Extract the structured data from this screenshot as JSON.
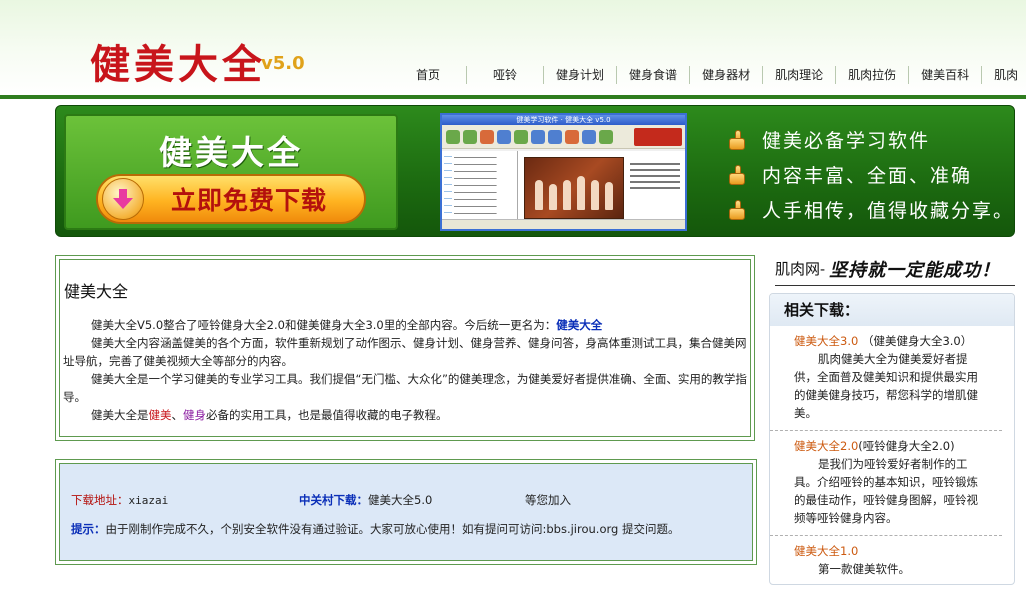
{
  "header": {
    "logo_text": "健美大全",
    "version": "v5.0",
    "nav": [
      "首页",
      "哑铃",
      "健身计划",
      "健身食谱",
      "健身器材",
      "肌肉理论",
      "肌肉拉伤",
      "健美百科",
      "肌肉"
    ]
  },
  "banner": {
    "title": "健美大全",
    "download_button": "立即免费下载",
    "download_icon": "download-arrow-icon",
    "screenshot_title": "健美学习软件 · 健美大全 v5.0",
    "features": [
      "健美必备学习软件",
      "内容丰富、全面、准确",
      "人手相传，值得收藏分享。"
    ]
  },
  "intro": {
    "title": "健美大全",
    "p1_text": "健美大全V5.0整合了哑铃健身大全2.0和健美健身大全3.0里的全部内容。今后统一更名为：",
    "p1_highlight": "健美大全",
    "p2": "健美大全内容涵盖健美的各个方面，软件重新规划了动作图示、健身计划、健身营养、健身问答，身高体重测试工具，集合健美网址导航，完善了健美视频大全等部分的内容。",
    "p3": "健美大全是一个学习健美的专业学习工具。我们提倡“无门槛、大众化”的健美理念，为健美爱好者提供准确、全面、实用的教学指导。",
    "p4_a": "健美大全是",
    "p4_b": "健美",
    "p4_sep": "、",
    "p4_c": "健身",
    "p4_d": "必备的实用工具，也是最值得收藏的电子教程。"
  },
  "download": {
    "addr_label": "下载地址：",
    "addr_value": "xiazai",
    "zgc_label": "中关村下载：",
    "zgc_value": "健美大全5.0",
    "wait": "等您加入",
    "tip_label": "提示：",
    "tip_text": "由于刚制作完成不久，个别安全软件没有通过验证。大家可放心使用！如有提问可访问:bbs.jirou.org 提交问题。"
  },
  "sidebar": {
    "slogan_site": "肌肉网-",
    "slogan_hand": "坚持就一定能成功！",
    "related_title": "相关下载：",
    "items": [
      {
        "name": "健美大全3.0",
        "sub": "（健美健身大全3.0）",
        "desc": "肌肉健美大全为健美爱好者提供，全面普及健美知识和提供最实用的健美健身技巧，帮您科学的增肌健美。"
      },
      {
        "name": "健美大全2.0",
        "sub": "(哑铃健身大全2.0)",
        "desc": "是我们为哑铃爱好者制作的工具。介绍哑铃的基本知识，哑铃锻炼的最佳动作，哑铃健身图解，哑铃视频等哑铃健身内容。"
      },
      {
        "name": "健美大全1.0",
        "sub": "",
        "desc": "第一款健美软件。"
      }
    ]
  }
}
